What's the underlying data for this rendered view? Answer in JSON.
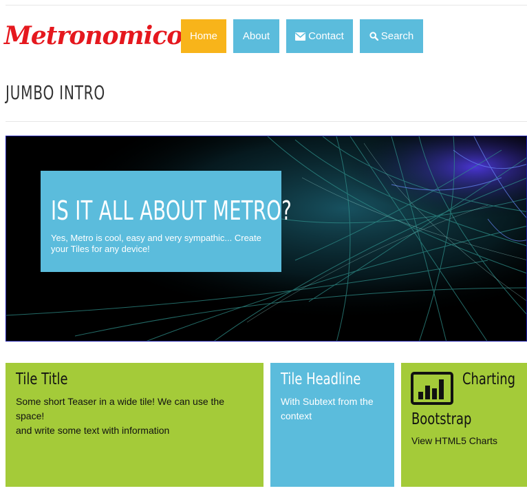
{
  "brand": {
    "logo_text": "Metronomico"
  },
  "nav": {
    "items": [
      {
        "label": "Home",
        "icon": "",
        "active": true
      },
      {
        "label": "About",
        "icon": "",
        "active": false
      },
      {
        "label": "Contact",
        "icon": "envelope-icon",
        "active": false
      },
      {
        "label": "Search",
        "icon": "search-icon",
        "active": false
      }
    ]
  },
  "section": {
    "title": "JUMBO INTRO"
  },
  "jumbotron": {
    "heading": "IS IT ALL ABOUT METRO?",
    "text": "Yes, Metro is cool, easy and very sympathic... Create your Tiles for any device!"
  },
  "tiles": [
    {
      "title": "Tile Title",
      "line1": "Some short Teaser in a wide tile! We can use the space!",
      "line2": "and write some text with information",
      "color": "#a4cb39"
    },
    {
      "title": "Tile Headline",
      "text": "With Subtext from the context",
      "color": "#5bbcdc"
    },
    {
      "title": "Charting",
      "subtitle": "Bootstrap",
      "text": "View HTML5 Charts",
      "icon": "bar-chart-icon",
      "color": "#a4cb39"
    }
  ],
  "colors": {
    "accent": "#5bbcdc",
    "active": "#f8b41a",
    "tile_green": "#a4cb39",
    "logo_red": "#e5181e"
  }
}
